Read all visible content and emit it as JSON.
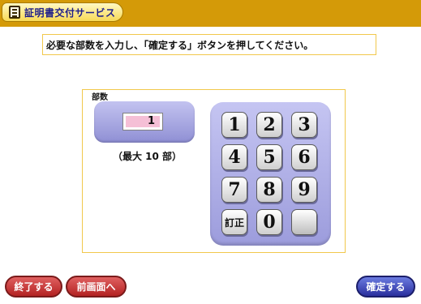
{
  "header": {
    "title": "証明書交付サービス",
    "icon": "document-icon"
  },
  "instruction": "必要な部数を入力し、「確定する」ボタンを押してください。",
  "count": {
    "label": "部数",
    "value": "1",
    "max_text": "（最大 10 部）"
  },
  "keypad": {
    "k1": "1",
    "k2": "2",
    "k3": "3",
    "k4": "4",
    "k5": "5",
    "k6": "6",
    "k7": "7",
    "k8": "8",
    "k9": "9",
    "correct": "訂正",
    "k0": "0"
  },
  "buttons": {
    "exit": "終了する",
    "back": "前画面へ",
    "confirm": "確定する"
  },
  "colors": {
    "header": "#d49a08",
    "accent_border": "#f1c84c",
    "keypad": "#b0b0e8",
    "field": "#f5bfd6",
    "exit": "#c62f2f",
    "confirm": "#2f3aa8"
  }
}
